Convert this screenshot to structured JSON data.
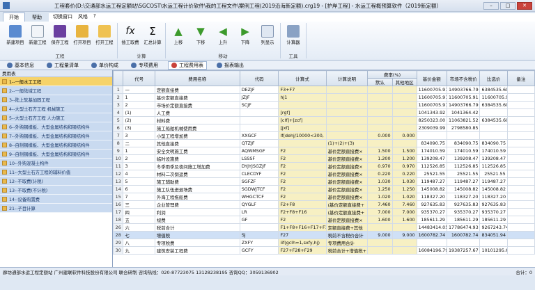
{
  "app": {
    "title": "工程套价(D:\\交通部水运工程定额站\\SGCOST\\水运工程计价软件\\我的工程文件\\案例工程(2019沿海新定额).crg19 - [护岸工程] - 水运工程概预算软件（2019新定额）"
  },
  "menu": {
    "tabs": [
      "开始",
      "帮助"
    ],
    "right": [
      "切换窗口",
      "风格",
      "?"
    ]
  },
  "ribbon": {
    "groups": [
      {
        "label": "工程",
        "buttons": [
          "新建项目",
          "新建工程",
          "保存工程",
          "打开项目",
          "打开工程"
        ]
      },
      {
        "label": "计算",
        "buttons": [
          "插工取费",
          "汇总计算"
        ]
      },
      {
        "label": "移动",
        "buttons": [
          "上移",
          "下移",
          "上升",
          "下降",
          "列显示"
        ]
      },
      {
        "label": "工具",
        "buttons": [
          "计算器"
        ]
      }
    ]
  },
  "view_tabs": [
    "基本信息",
    "工程量清单",
    "单价构成",
    "专项费用",
    "工程费用表",
    "报表输出"
  ],
  "left_panel": {
    "header": "费用表",
    "items": [
      "1--一般水工工程",
      "2--一般陆域工程",
      "3--陆上软基加固工程",
      "4--大型土石方工程 机械施工",
      "5--大型土石方工程 人力施工",
      "6--外购钢模板、大型金属结构和钢结构件",
      "7--外购钢模板、大型金属结构和钢结构件",
      "8--自制钢模板、大型金属结构和钢结构件",
      "9--自制钢模板、大型金属结构和钢结构件",
      "10--外购混凝土构件",
      "11--大型土石方工程的辅料价值",
      "12--不取费(计税)",
      "13--不取费(不计税)",
      "14--设备购置费",
      "21--子目计算"
    ],
    "selected": 0
  },
  "table": {
    "headers": [
      "代号",
      "费用名称",
      "代码",
      "计算式",
      "计算说明",
      "费率(%)",
      "基价金额",
      "市场不含税价",
      "比选价",
      "备注"
    ],
    "rate_sub": [
      "默认",
      "其他地区"
    ],
    "rows": [
      {
        "n": "1",
        "code": "一",
        "name": "定额直接费",
        "dm": "DEZJF",
        "formula": "F3+F7",
        "desc": "",
        "r1": "",
        "r2": "",
        "base": "11600705.91",
        "market": "14903766.79",
        "cmp": "6384535.60"
      },
      {
        "n": "2",
        "code": "1",
        "name": "基价定额直接费",
        "dm": "JZJF",
        "formula": "hj1",
        "desc": "",
        "r1": "",
        "r2": "",
        "base": "11600705.91",
        "market": "11600705.91",
        "cmp": "11600705.91"
      },
      {
        "n": "3",
        "code": "2",
        "name": "市场价定额直接费",
        "dm": "SCJF",
        "formula": "",
        "desc": "",
        "r1": "",
        "r2": "",
        "base": "11600705.91",
        "market": "14903766.79",
        "cmp": "6384535.60"
      },
      {
        "n": "4",
        "code": "(1)",
        "name": "人工费",
        "dm": "",
        "formula": "[rgf]",
        "desc": "",
        "r1": "",
        "r2": "",
        "base": "1041343.92",
        "market": "1041364.42",
        "cmp": ""
      },
      {
        "n": "5",
        "code": "(2)",
        "name": "材料费",
        "dm": "",
        "formula": "[clf]+[zcf]",
        "desc": "",
        "r1": "",
        "r2": "",
        "base": "8250323.00",
        "market": "11063821.52",
        "cmp": "6384535.60"
      },
      {
        "n": "6",
        "code": "(3)",
        "name": "施工船舶机械使用费",
        "dm": "",
        "formula": "[jxf]",
        "desc": "",
        "r1": "",
        "r2": "",
        "base": "2309039.99",
        "market": "2798580.85",
        "cmp": ""
      },
      {
        "n": "7",
        "code": "3",
        "name": "小型工程增加费",
        "dm": "XXGCF",
        "formula": "if(dehj/10000<300,",
        "desc": "",
        "r1": "0.000",
        "r2": "0.000",
        "base": "",
        "market": "",
        "cmp": ""
      },
      {
        "n": "8",
        "code": "二",
        "name": "其他直接费",
        "dm": "QTZJF",
        "formula": "",
        "desc": "(1)+(2)+(3)",
        "r1": "",
        "r2": "",
        "base": "834090.75",
        "market": "834090.75",
        "cmp": "834090.75"
      },
      {
        "n": "9",
        "code": "1",
        "name": "安全文明施工费",
        "dm": "AQWMSGF",
        "formula": "F2",
        "desc": "基价定额直接费×",
        "r1": "1.500",
        "r2": "1.500",
        "base": "174010.59",
        "market": "174010.59",
        "cmp": "174010.59"
      },
      {
        "n": "10",
        "code": "2",
        "name": "临时设施费",
        "dm": "LSSSF",
        "formula": "F2",
        "desc": "基价定额直接费×",
        "r1": "1.200",
        "r2": "1.200",
        "base": "139208.47",
        "market": "139208.47",
        "cmp": "139208.47"
      },
      {
        "n": "11",
        "code": "3",
        "name": "冬季雨季及夜间施工增加费",
        "dm": "DYJYJSGZJF",
        "formula": "F2",
        "desc": "基价定额直接费×",
        "r1": "0.970",
        "r2": "0.970",
        "base": "112526.85",
        "market": "112526.85",
        "cmp": "112526.85"
      },
      {
        "n": "12",
        "code": "4",
        "name": "材料二次倒运费",
        "dm": "CLECDYF",
        "formula": "F2",
        "desc": "基价定额直接费×",
        "r1": "0.220",
        "r2": "0.220",
        "base": "25521.55",
        "market": "25521.55",
        "cmp": "25521.55"
      },
      {
        "n": "13",
        "code": "5",
        "name": "施工辅助费",
        "dm": "SGFZF",
        "formula": "F2",
        "desc": "基价定额直接费×",
        "r1": "1.030",
        "r2": "1.030",
        "base": "119487.27",
        "market": "119487.27",
        "cmp": "119487.27"
      },
      {
        "n": "14",
        "code": "6",
        "name": "施工队伍进退场费",
        "dm": "SGDWJTCF",
        "formula": "F2",
        "desc": "基价定额直接费×",
        "r1": "1.250",
        "r2": "1.250",
        "base": "145008.82",
        "market": "145008.82",
        "cmp": "145008.82"
      },
      {
        "n": "15",
        "code": "7",
        "name": "外海工程拖船费",
        "dm": "WHGCTCF",
        "formula": "F2",
        "desc": "基价定额直接费×",
        "r1": "1.020",
        "r2": "1.020",
        "base": "118327.20",
        "market": "118327.20",
        "cmp": "118327.20"
      },
      {
        "n": "16",
        "code": "三",
        "name": "企业管理费",
        "dm": "QYGLF",
        "formula": "F2+F8",
        "desc": "(基价定额直接费+",
        "r1": "7.460",
        "r2": "7.460",
        "base": "927635.83",
        "market": "927635.83",
        "cmp": "927635.83"
      },
      {
        "n": "17",
        "code": "四",
        "name": "利润",
        "dm": "LR",
        "formula": "F2+F8+F16",
        "desc": "(基价定额直接费+",
        "r1": "7.000",
        "r2": "7.000",
        "base": "935370.27",
        "market": "935370.27",
        "cmp": "935370.27"
      },
      {
        "n": "18",
        "code": "五",
        "name": "规费",
        "dm": "GF",
        "formula": "F2",
        "desc": "基价定额直接费×",
        "r1": "1.600",
        "r2": "1.600",
        "base": "185611.29",
        "market": "185611.29",
        "cmp": "185611.29"
      },
      {
        "n": "26",
        "code": "六",
        "name": "税前合计",
        "dm": "",
        "formula": "F1+F8+F16+F17+F18",
        "desc": "定额直接费+其他",
        "r1": "",
        "r2": "",
        "base": "14483414.05",
        "market": "17786474.93",
        "cmp": "9267243.74"
      },
      {
        "n": "28",
        "code": "七",
        "name": "增值税",
        "dm": "SJ",
        "formula": "F27",
        "desc": "税前不含税价合计",
        "r1": "9.000",
        "r2": "9.000",
        "base": "1600782.74",
        "market": "1600782.74",
        "cmp": "834051.94"
      },
      {
        "n": "29",
        "code": "八",
        "name": "专项税费",
        "dm": "ZXFY",
        "formula": "iif(gclh=1,sxfy,hj)",
        "desc": "专项费用合计",
        "r1": "",
        "r2": "",
        "base": "",
        "market": "",
        "cmp": ""
      },
      {
        "n": "30",
        "code": "九",
        "name": "建筑安装工程费",
        "dm": "GCFY",
        "formula": "F27+F28+F29",
        "desc": "税前合计+增值税+",
        "r1": "",
        "r2": "",
        "base": "16084196.79",
        "market": "19387257.67",
        "cmp": "10101295.68"
      }
    ],
    "selected_row": 19
  },
  "status": {
    "left": "廊坊通部水运工程定额站  广州建联软件科技股份有限公司  联合研制  咨询热线：020-87723075  13128238195  咨询QQ：3059136902",
    "right": "合计：0"
  }
}
